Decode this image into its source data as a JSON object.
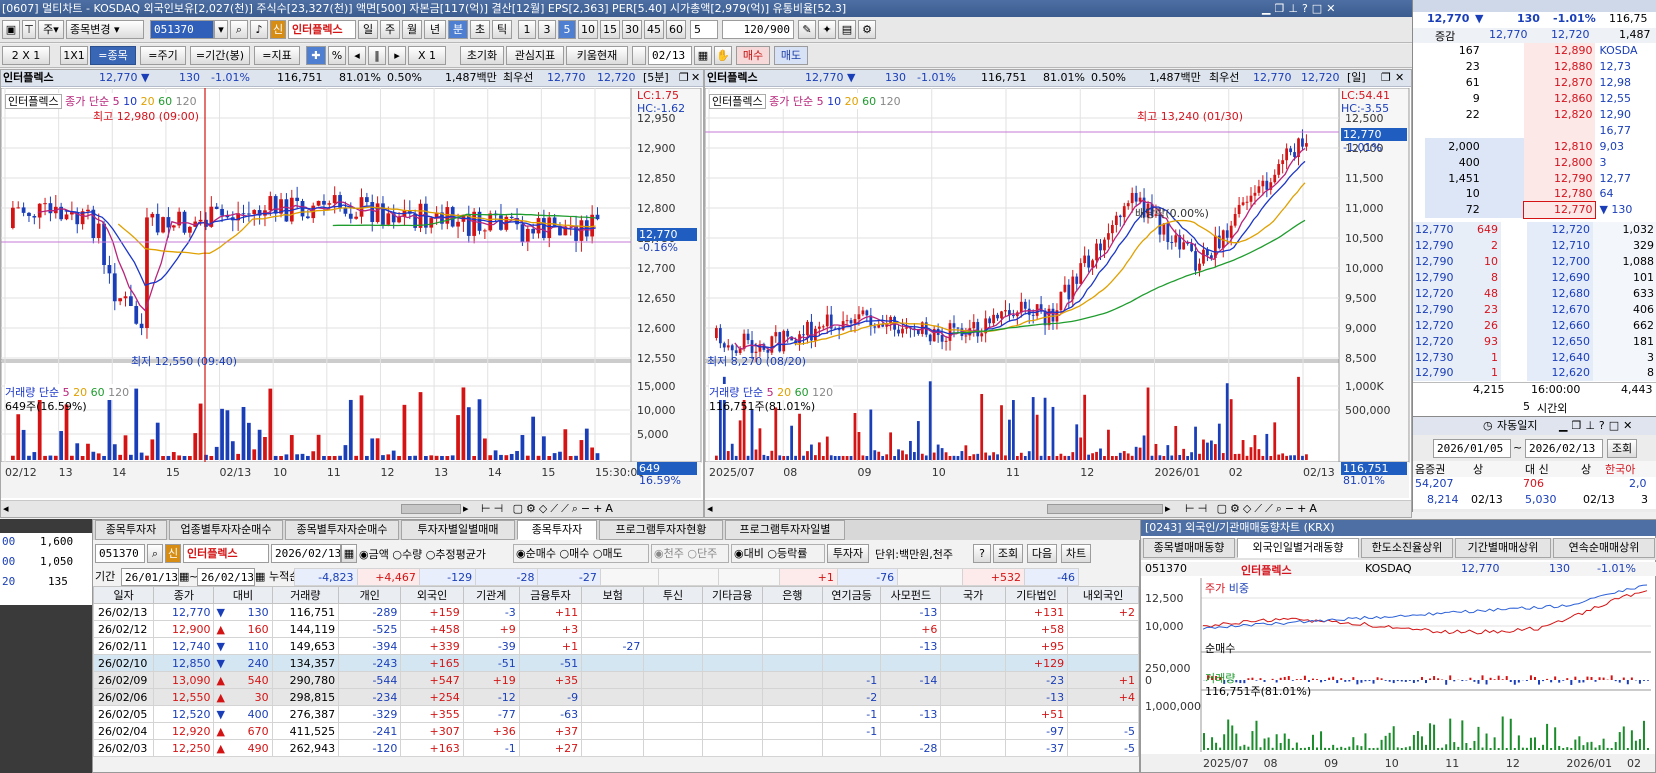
{
  "window": {
    "title": "[0607] 멀티차트 - KOSDAQ 외국인보유[2,027(천)] 주식수[23,327(천)] 액면[500] 자본금[117(억)] 결산[12월] EPS[2,363] PER[5.40] 시가총액[2,979(억)] 유통비율[52.3]"
  },
  "toolbar": {
    "stock_change_label": "종목변경",
    "stock_code": "051370",
    "stock_name": "인터플렉스",
    "stock_badge": "신",
    "periods": [
      "일",
      "주",
      "월",
      "년",
      "분",
      "초",
      "틱"
    ],
    "period_selected": "분",
    "intervals": [
      "1",
      "3",
      "5",
      "10",
      "15",
      "30",
      "45",
      "60"
    ],
    "interval_selected": "5",
    "interval_value": "5",
    "count_value": "120/900",
    "layout_label": "2 X 1",
    "one_by_one": "1X1",
    "eq_stock": "=종목",
    "eq_period": "=주기",
    "eq_range": "=기간(봉)",
    "eq_indicator": "=지표",
    "zoom_label": "X 1",
    "reset_label": "초기화",
    "watch_label": "관심지표",
    "kiwoom_label": "키움현재",
    "date_label": "02/13",
    "buy_label": "매수",
    "sell_label": "매도"
  },
  "chart_left": {
    "head": {
      "name": "인터플렉스",
      "price": "12,770",
      "change": "130",
      "rate": "-1.01%",
      "volume": "116,751",
      "ratio": "81.01%",
      "weight": "0.50%",
      "amount": "1,487백만",
      "best": "최우선",
      "ask": "12,770",
      "bid": "12,720",
      "period": "[5분]"
    },
    "legend_name": "인터플렉스",
    "legend_text": "종가 단순",
    "ma_labels": [
      "5",
      "10",
      "20",
      "60",
      "120"
    ],
    "high_label": "최고 12,980 (09:00)",
    "low_label": "최저 12,550 (09:40)",
    "lc": "LC:1.75",
    "hc": "HC:-1.62",
    "price_ticks": [
      "12,950",
      "12,900",
      "12,850",
      "12,800",
      "12,750",
      "12,700",
      "12,650",
      "12,600",
      "12,550"
    ],
    "current_price_tag": "12,770",
    "current_rate_tag": "-0.16%",
    "vol_legend": "거래량 단순",
    "vol_ma": [
      "5",
      "20",
      "60",
      "120"
    ],
    "vol_sub": "649주(16.59%)",
    "vol_ticks": [
      "15,000",
      "10,000",
      "5,000"
    ],
    "vol_tag": "649",
    "vol_rate": "16.59%",
    "x_labels": [
      "02/12",
      "13",
      "14",
      "15",
      "02/13",
      "10",
      "11",
      "12",
      "13",
      "14",
      "15",
      "15:30:00"
    ]
  },
  "chart_right": {
    "head": {
      "name": "인터플렉스",
      "price": "12,770",
      "change": "130",
      "rate": "-1.01%",
      "volume": "116,751",
      "ratio": "81.01%",
      "weight": "0.50%",
      "amount": "1,487백만",
      "best": "최우선",
      "ask": "12,770",
      "bid": "12,720",
      "period": "[일]"
    },
    "legend_name": "인터플렉스",
    "legend_text": "종가 단순",
    "ma_labels": [
      "5",
      "10",
      "20",
      "60",
      "120"
    ],
    "high_label": "최고 13,240 (01/30)",
    "low_label": "최저 8,270 (08/20)",
    "annotation": "배당락(0.00%)",
    "lc": "LC:54.41",
    "hc": "HC:-3.55",
    "price_ticks": [
      "12,500",
      "12,000",
      "11,500",
      "11,000",
      "10,500",
      "10,000",
      "9,500",
      "9,000",
      "8,500"
    ],
    "current_price_tag": "12,770",
    "current_rate_tag": "-1.01%",
    "vol_legend": "거래량 단순",
    "vol_ma": [
      "5",
      "20",
      "60",
      "120"
    ],
    "vol_sub": "116,751주(81.01%)",
    "vol_ticks": [
      "1,000K",
      "500,000"
    ],
    "vol_tag": "116,751",
    "vol_rate": "81.01%",
    "x_labels": [
      "2025/07",
      "08",
      "09",
      "10",
      "11",
      "12",
      "2026/01",
      "02",
      "02/13"
    ]
  },
  "orderbook": {
    "price": "12,770",
    "change": "130",
    "rate": "-1.01%",
    "volume": "116,75",
    "head_label": "증감",
    "head_price1": "12,770",
    "head_price2": "12,720",
    "head_qty": "1,487",
    "asks": [
      {
        "qty": "167",
        "price": "12,890",
        "side": "KOSDA"
      },
      {
        "qty": "23",
        "price": "12,880",
        "side": "12,73"
      },
      {
        "qty": "61",
        "price": "12,870",
        "side": "12,98"
      },
      {
        "qty": "9",
        "price": "12,860",
        "side": "12,55"
      },
      {
        "qty": "22",
        "price": "12,820",
        "side": "12,90"
      },
      {
        "qty": "",
        "price": "",
        "side": "16,77"
      },
      {
        "qty": "2,000",
        "price": "12,810",
        "side": "9,03"
      },
      {
        "qty": "400",
        "price": "12,800",
        "side": "3"
      },
      {
        "qty": "1,451",
        "price": "12,790",
        "side": "12,77"
      },
      {
        "qty": "10",
        "price": "12,780",
        "side": "64"
      },
      {
        "qty": "72",
        "price": "12,770",
        "side": "▼ 130"
      }
    ],
    "bids": [
      {
        "tick": "12,770",
        "tq": "649",
        "price": "12,720",
        "qty": "1,032"
      },
      {
        "tick": "12,790",
        "tq": "2",
        "price": "12,710",
        "qty": "329"
      },
      {
        "tick": "12,790",
        "tq": "10",
        "price": "12,700",
        "qty": "1,088"
      },
      {
        "tick": "12,790",
        "tq": "8",
        "price": "12,690",
        "qty": "101"
      },
      {
        "tick": "12,720",
        "tq": "48",
        "price": "12,680",
        "qty": "633"
      },
      {
        "tick": "12,790",
        "tq": "23",
        "price": "12,670",
        "qty": "406"
      },
      {
        "tick": "12,720",
        "tq": "26",
        "price": "12,660",
        "qty": "662"
      },
      {
        "tick": "12,720",
        "tq": "93",
        "price": "12,650",
        "qty": "181"
      },
      {
        "tick": "12,730",
        "tq": "1",
        "price": "12,640",
        "qty": "3"
      },
      {
        "tick": "12,790",
        "tq": "1",
        "price": "12,620",
        "qty": "8"
      }
    ],
    "total_ask": "4,215",
    "time": "16:00:00",
    "total_bid": "4,443",
    "after_hours_qty": "5",
    "after_hours_label": "시간외"
  },
  "autojournal": {
    "title": "자동일지",
    "date_from": "2026/01/05",
    "date_to": "2026/02/13",
    "query": "조회",
    "col_a": "옴증권",
    "col_b": "상",
    "col_c": "대 신",
    "col_d": "상",
    "col_e": "한국아",
    "rows": [
      {
        "a": "54,207",
        "b": "",
        "c": "706",
        "d": "",
        "e": "2,0"
      },
      {
        "a": "8,214",
        "b": "02/13",
        "c": "5,030",
        "d": "02/13",
        "e": "3"
      }
    ]
  },
  "left_strip": {
    "rows": [
      {
        "a": "00",
        "b": "1,600"
      },
      {
        "a": "00",
        "b": "1,050"
      },
      {
        "a": "20",
        "b": "135"
      }
    ]
  },
  "investor": {
    "tabs": [
      "종목투자자",
      "업종별투자자순매수",
      "종목별투자자순매수",
      "투자자별일별매매",
      "종목투자자",
      "프로그램투자자현황",
      "프로그램투자자일별"
    ],
    "code": "051370",
    "name": "인터플렉스",
    "badge": "신",
    "date": "2026/02/13",
    "radio_amount": "금액",
    "radio_qty": "수량",
    "radio_avg": "추정평균가",
    "radio_net": "순매수",
    "radio_buy": "매수",
    "radio_sell": "매도",
    "radio_1k": "천주",
    "radio_single": "단주",
    "radio_vs": "대비",
    "radio_rate": "등락률",
    "investor_btn": "투자자",
    "unit": "단위:백만원,천주",
    "help": "?",
    "query": "조회",
    "next": "다음",
    "chart": "차트",
    "period_label": "기간",
    "from": "26/01/13",
    "to": "26/02/13",
    "cum_label": "누적순매수",
    "cum": [
      "-4,823",
      "+4,467",
      "-129",
      "-28",
      "-27",
      "",
      "",
      "",
      "+1",
      "-76",
      "",
      "+532",
      "-46"
    ],
    "columns": [
      "일자",
      "종가",
      "대비",
      "거래량",
      "개인",
      "외국인",
      "기관계",
      "금융투자",
      "보험",
      "투신",
      "기타금융",
      "은행",
      "연기금등",
      "사모펀드",
      "국가",
      "기타법인",
      "내외국인"
    ],
    "rows": [
      {
        "date": "26/02/13",
        "close": "12,770",
        "dir": "▼",
        "chg": "130",
        "vol": "116,751",
        "ind": "-289",
        "frn": "+159",
        "inst": "-3",
        "fin": "+11",
        "ins": "",
        "inv": "",
        "etc": "",
        "bank": "",
        "pens": "",
        "pef": "-13",
        "gov": "",
        "corp": "+131",
        "dom": "+2"
      },
      {
        "date": "26/02/12",
        "close": "12,900",
        "dir": "▲",
        "chg": "160",
        "vol": "144,119",
        "ind": "-525",
        "frn": "+458",
        "inst": "+9",
        "fin": "+3",
        "ins": "",
        "inv": "",
        "etc": "",
        "bank": "",
        "pens": "",
        "pef": "+6",
        "gov": "",
        "corp": "+58",
        "dom": ""
      },
      {
        "date": "26/02/11",
        "close": "12,740",
        "dir": "▼",
        "chg": "110",
        "vol": "149,653",
        "ind": "-394",
        "frn": "+339",
        "inst": "-39",
        "fin": "+1",
        "ins": "-27",
        "inv": "",
        "etc": "",
        "bank": "",
        "pens": "",
        "pef": "-13",
        "gov": "",
        "corp": "+95",
        "dom": ""
      },
      {
        "date": "26/02/10",
        "close": "12,850",
        "dir": "▼",
        "chg": "240",
        "vol": "134,357",
        "ind": "-243",
        "frn": "+165",
        "inst": "-51",
        "fin": "-51",
        "ins": "",
        "inv": "",
        "etc": "",
        "bank": "",
        "pens": "",
        "pef": "",
        "gov": "",
        "corp": "+129",
        "dom": ""
      },
      {
        "date": "26/02/09",
        "close": "13,090",
        "dir": "▲",
        "chg": "540",
        "vol": "290,780",
        "ind": "-544",
        "frn": "+547",
        "inst": "+19",
        "fin": "+35",
        "ins": "",
        "inv": "",
        "etc": "",
        "bank": "",
        "pens": "-1",
        "pef": "-14",
        "gov": "",
        "corp": "-23",
        "dom": "+1"
      },
      {
        "date": "26/02/06",
        "close": "12,550",
        "dir": "▲",
        "chg": "30",
        "vol": "298,815",
        "ind": "-234",
        "frn": "+254",
        "inst": "-12",
        "fin": "-9",
        "ins": "",
        "inv": "",
        "etc": "",
        "bank": "",
        "pens": "-2",
        "pef": "",
        "gov": "",
        "corp": "-13",
        "dom": "+4"
      },
      {
        "date": "26/02/05",
        "close": "12,520",
        "dir": "▼",
        "chg": "400",
        "vol": "276,387",
        "ind": "-329",
        "frn": "+355",
        "inst": "-77",
        "fin": "-63",
        "ins": "",
        "inv": "",
        "etc": "",
        "bank": "",
        "pens": "-1",
        "pef": "-13",
        "gov": "",
        "corp": "+51",
        "dom": ""
      },
      {
        "date": "26/02/04",
        "close": "12,920",
        "dir": "▲",
        "chg": "670",
        "vol": "411,525",
        "ind": "-241",
        "frn": "+307",
        "inst": "+36",
        "fin": "+37",
        "ins": "",
        "inv": "",
        "etc": "",
        "bank": "",
        "pens": "-1",
        "pef": "",
        "gov": "",
        "corp": "-97",
        "dom": "-5"
      },
      {
        "date": "26/02/03",
        "close": "12,250",
        "dir": "▲",
        "chg": "490",
        "vol": "262,943",
        "ind": "-120",
        "frn": "+163",
        "inst": "-1",
        "fin": "+27",
        "ins": "",
        "inv": "",
        "etc": "",
        "bank": "",
        "pens": "",
        "pef": "-28",
        "gov": "",
        "corp": "-37",
        "dom": "-5"
      }
    ]
  },
  "foreign_panel": {
    "title": "[0243] 외국인/기관매매동향차트 (KRX)",
    "tabs": [
      "종목별매매동향",
      "외국인일별거래동향",
      "한도소진율상위",
      "기간별매매상위",
      "연속순매매상위"
    ],
    "tab_selected": "외국인일별거래동향",
    "code": "051370",
    "name": "인터플렉스",
    "market": "KOSDAQ",
    "price": "12,770",
    "change": "130",
    "rate": "-1.01%",
    "price_legend": "주가",
    "ratio_legend": "비중",
    "price_ticks": [
      "12,500",
      "10,000"
    ],
    "net_legend": "순매수",
    "net_ticks": [
      "250,000",
      "0"
    ],
    "vol_legend": "거래량",
    "vol_ticks": [
      "1,000,000"
    ],
    "vol_sub": "116,751주(81.01%)",
    "x_labels": [
      "2025/07",
      "08",
      "09",
      "10",
      "11",
      "12",
      "2026/01",
      "02"
    ]
  }
}
